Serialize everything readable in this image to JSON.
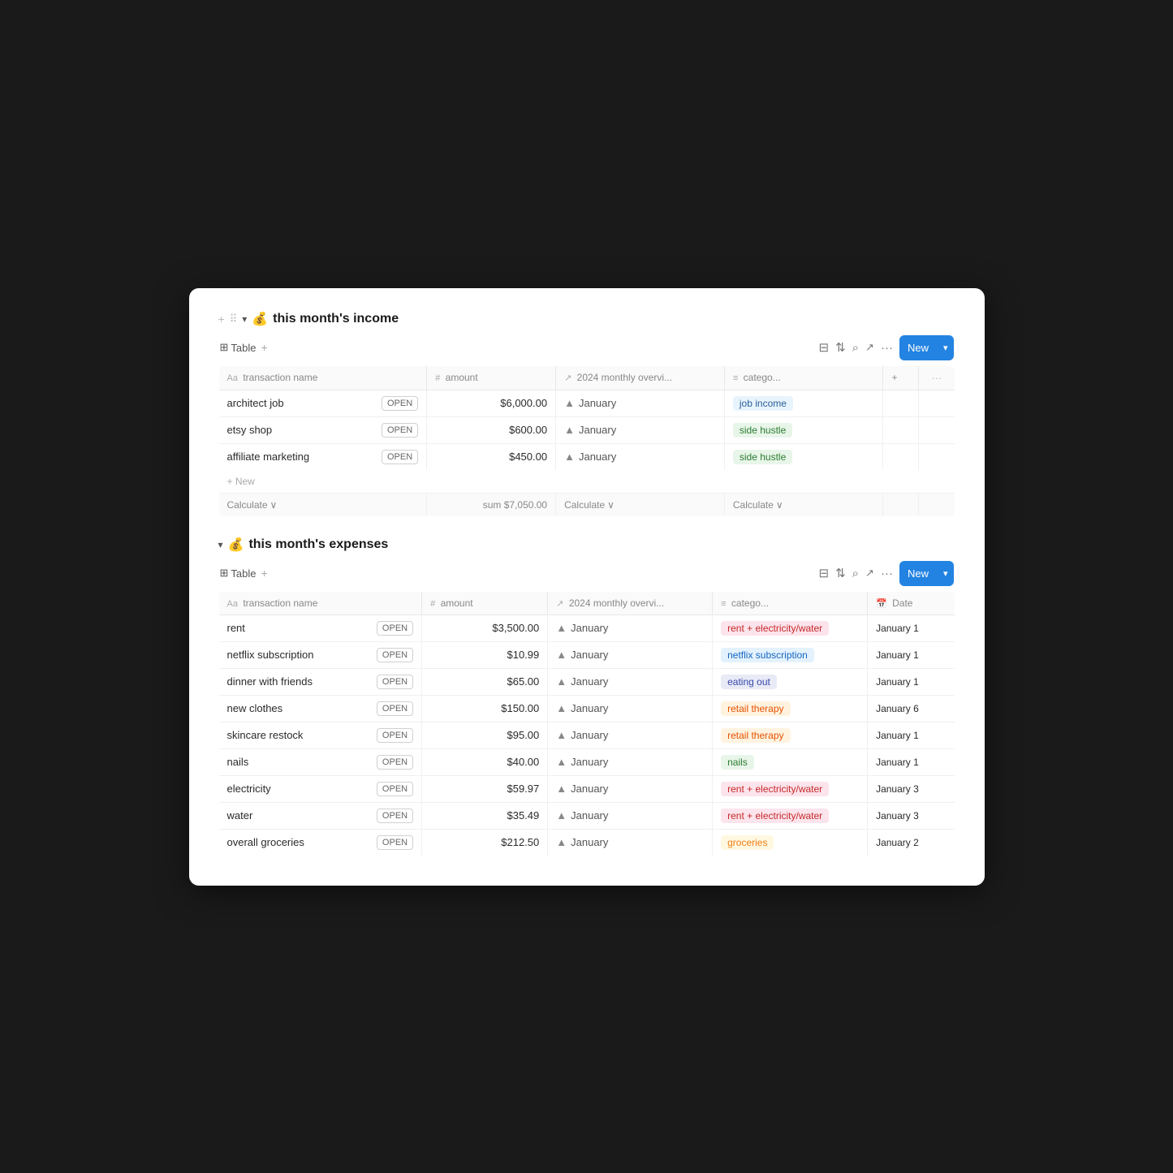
{
  "income": {
    "section_title": "this month's income",
    "section_emoji": "💰",
    "toolbar": {
      "table_label": "Table",
      "new_label": "New",
      "arrow_label": "▾"
    },
    "columns": {
      "name": "transaction name",
      "amount": "amount",
      "monthly": "2024 monthly overvi...",
      "category": "catego..."
    },
    "rows": [
      {
        "name": "architect job",
        "amount": "$6,000.00",
        "monthly": "January",
        "category": "job income",
        "category_class": "badge-job-income"
      },
      {
        "name": "etsy shop",
        "amount": "$600.00",
        "monthly": "January",
        "category": "side hustle",
        "category_class": "badge-side-hustle"
      },
      {
        "name": "affiliate marketing",
        "amount": "$450.00",
        "monthly": "January",
        "category": "side hustle",
        "category_class": "badge-side-hustle"
      }
    ],
    "footer": {
      "calculate_left": "Calculate ∨",
      "sum": "sum $7,050.00",
      "calculate_mid": "Calculate ∨",
      "calculate_right": "Calculate ∨"
    },
    "new_row_label": "+ New"
  },
  "expenses": {
    "section_title": "this month's expenses",
    "section_emoji": "💰",
    "toolbar": {
      "table_label": "Table",
      "new_label": "New",
      "arrow_label": "▾"
    },
    "columns": {
      "name": "transaction name",
      "amount": "amount",
      "monthly": "2024 monthly overvi...",
      "category": "catego...",
      "date": "Date"
    },
    "rows": [
      {
        "name": "rent",
        "amount": "$3,500.00",
        "monthly": "January",
        "category": "rent + electricity/water",
        "category_class": "badge-rent-electricity",
        "date": "January 1"
      },
      {
        "name": "netflix subscription",
        "amount": "$10.99",
        "monthly": "January",
        "category": "netflix subscription",
        "category_class": "badge-netflix",
        "date": "January 1"
      },
      {
        "name": "dinner with friends",
        "amount": "$65.00",
        "monthly": "January",
        "category": "eating out",
        "category_class": "badge-eating-out",
        "date": "January 1"
      },
      {
        "name": "new clothes",
        "amount": "$150.00",
        "monthly": "January",
        "category": "retail therapy",
        "category_class": "badge-retail-therapy",
        "date": "January 6"
      },
      {
        "name": "skincare restock",
        "amount": "$95.00",
        "monthly": "January",
        "category": "retail therapy",
        "category_class": "badge-retail-therapy",
        "date": "January 1"
      },
      {
        "name": "nails",
        "amount": "$40.00",
        "monthly": "January",
        "category": "nails",
        "category_class": "badge-nails",
        "date": "January 1"
      },
      {
        "name": "electricity",
        "amount": "$59.97",
        "monthly": "January",
        "category": "rent + electricity/water",
        "category_class": "badge-rent-electricity",
        "date": "January 3"
      },
      {
        "name": "water",
        "amount": "$35.49",
        "monthly": "January",
        "category": "rent + electricity/water",
        "category_class": "badge-rent-electricity",
        "date": "January 3"
      },
      {
        "name": "overall groceries",
        "amount": "$212.50",
        "monthly": "January",
        "category": "groceries",
        "category_class": "badge-groceries",
        "date": "January 2"
      }
    ]
  },
  "icons": {
    "plus": "+",
    "dots_grid": "⠿",
    "chevron_down": "▾",
    "filter": "⊟",
    "sort": "⇅",
    "search": "⌕",
    "share": "↗",
    "more": "···",
    "table_icon": "⊞",
    "aa_icon": "Aa",
    "hash_icon": "#",
    "arrow_icon": "↗",
    "list_icon": "≡",
    "calendar_icon": "📅",
    "bar_chart": "▲"
  }
}
